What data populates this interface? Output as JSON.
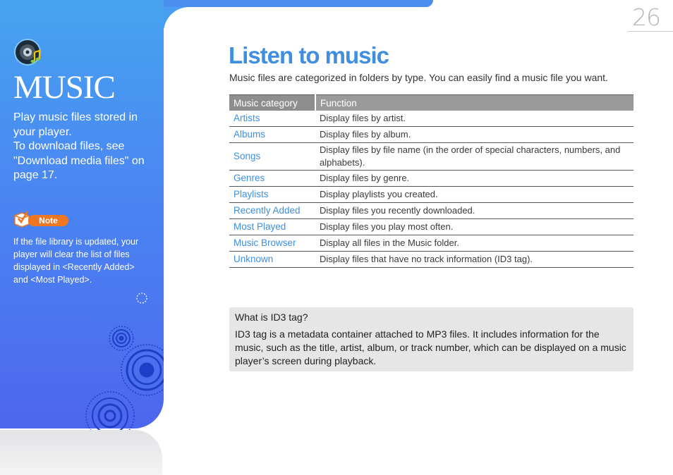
{
  "page_number": "26",
  "sidebar": {
    "section_title": "MUSIC",
    "intro_lines": [
      "Play music files stored in",
      "your player.",
      "To download files, see",
      "\"Download media files\" on",
      "page 17."
    ],
    "note_label": "Note",
    "note_lines": [
      "If the file library is updated, your",
      "player will clear the list of files",
      "displayed in <Recently Added>",
      "and <Most Played>."
    ]
  },
  "main": {
    "title": "Listen to music",
    "subtitle": "Music files are categorized in folders by type. You can easily find a music file you want.",
    "table": {
      "headers": [
        "Music category",
        "Function"
      ],
      "rows": [
        {
          "category": "Artists",
          "function": "Display files by artist."
        },
        {
          "category": "Albums",
          "function": "Display files by album."
        },
        {
          "category": "Songs",
          "function": "Display files by file name (in the order of special characters, numbers, and alphabets)."
        },
        {
          "category": "Genres",
          "function": "Display files by genre."
        },
        {
          "category": "Playlists",
          "function": "Display playlists you created."
        },
        {
          "category": "Recently Added",
          "function": "Display files you recently downloaded."
        },
        {
          "category": "Most Played",
          "function": "Display files you play most often."
        },
        {
          "category": "Music Browser",
          "function": "Display all files in the Music folder."
        },
        {
          "category": "Unknown",
          "function": "Display files that have no track information (ID3 tag)."
        }
      ]
    },
    "id3_box": {
      "question": "What is ID3 tag?",
      "answer": "ID3 tag is a metadata container attached to MP3 files. It includes information for the music, such as the title, artist, album, or track number, which can be displayed on a music player’s screen during playback."
    }
  },
  "icons": [
    "music-speaker-icon",
    "note-check-icon"
  ],
  "colors": {
    "sidebar_blue": "#4a86f2",
    "title_blue": "#3f8ee0",
    "link_blue": "#3c8fe1",
    "note_orange": "#f07722",
    "header_gray": "#9a9a9a",
    "box_gray": "#e6e6e6"
  }
}
